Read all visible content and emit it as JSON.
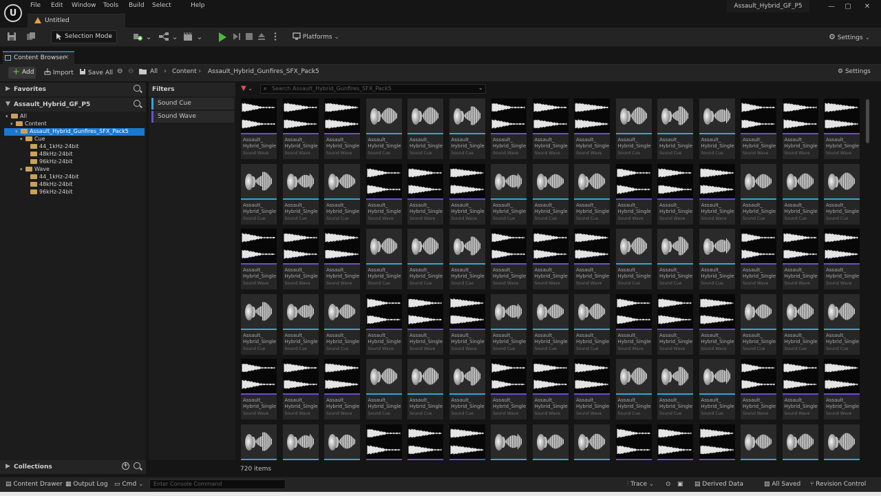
{
  "window": {
    "project_title": "Assault_Hybrid_GF_P5",
    "menu": [
      "File",
      "Edit",
      "Window",
      "Tools",
      "Build",
      "Select",
      "Help"
    ],
    "level_tab": "Untitled",
    "controls": {
      "minimize": "—",
      "maximize": "▢",
      "close": "✕"
    }
  },
  "toolbar": {
    "selection_mode": "Selection Mode",
    "platforms": "Platforms",
    "settings": "Settings"
  },
  "content_browser": {
    "tab_label": "Content Browser",
    "add_label": "Add",
    "import_label": "Import",
    "save_all_label": "Save All",
    "breadcrumb": [
      "All",
      "Content",
      "Assault_Hybrid_Gunfires_SFX_Pack5"
    ],
    "settings_label": "Settings",
    "favorites_label": "Favorites",
    "project_label": "Assault_Hybrid_GF_P5",
    "tree": [
      {
        "label": "All",
        "depth": 0
      },
      {
        "label": "Content",
        "depth": 1
      },
      {
        "label": "Assault_Hybrid_Gunfires_SFX_Pack5",
        "depth": 2
      },
      {
        "label": "Cue",
        "depth": 3
      },
      {
        "label": "44_1kHz-24bit",
        "depth": 4
      },
      {
        "label": "48kHz-24bit",
        "depth": 4
      },
      {
        "label": "96kHz-24bit",
        "depth": 4
      },
      {
        "label": "Wave",
        "depth": 3
      },
      {
        "label": "44_1kHz-24bit",
        "depth": 4
      },
      {
        "label": "48kHz-24bit",
        "depth": 4
      },
      {
        "label": "96kHz-24bit",
        "depth": 4
      }
    ],
    "filters_label": "Filters",
    "filters": [
      {
        "label": "Sound Cue",
        "color": "#2fa7d8"
      },
      {
        "label": "Sound Wave",
        "color": "#6a4fd0"
      }
    ],
    "search_placeholder": "Search Assault_Hybrid_Gunfires_SFX_Pack5",
    "asset_name_line1": "Assault_",
    "asset_name_line2": "Hybrid_Single",
    "asset_types": {
      "cue": "Sound Cue",
      "wave": "Sound Wave"
    },
    "asset_rows": [
      "WWWCCCWWWCCCWWW",
      "CCCWWWCCCWWWCCC",
      "WWWCCCWWWCCCWWW",
      "CCCWWWCCCWWWCCC",
      "WWWCCCWWWCCCWWW",
      "CCCWWWCCCWWWCCC"
    ],
    "item_count": "720 items",
    "collections_label": "Collections"
  },
  "colors": {
    "cue_strip": "#2fa7d8",
    "wave_strip": "#6a4fd0",
    "selection": "#1a78d2",
    "play": "#4cbb3a"
  },
  "statusbar": {
    "content_drawer": "Content Drawer",
    "output_log": "Output Log",
    "cmd": "Cmd",
    "cmd_placeholder": "Enter Console Command",
    "trace": "Trace",
    "derived_data": "Derived Data",
    "all_saved": "All Saved",
    "revision_control": "Revision Control"
  }
}
